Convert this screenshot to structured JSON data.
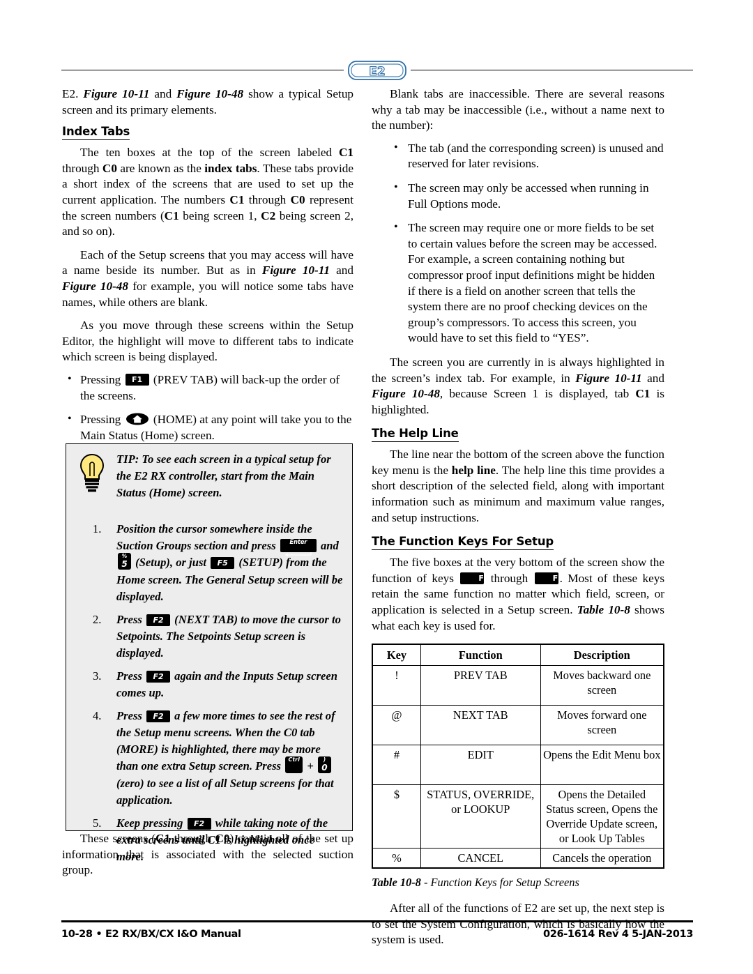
{
  "header": {
    "logo_text": "E2",
    "logo_color": "#2e6da4"
  },
  "left_column": {
    "intro_p1_a": "E2. ",
    "intro_p1_fig1": "Figure 10-11",
    "intro_p1_b": " and ",
    "intro_p1_fig2": "Figure 10-48",
    "intro_p1_c": " show a typical Setup screen and its primary elements.",
    "heading_index_tabs": "Index Tabs",
    "p_index_a": "The ten boxes at the top of the screen labeled ",
    "p_index_c1": "C1",
    "p_index_b": " through ",
    "p_index_c0": "C0",
    "p_index_c": " are known as the ",
    "p_index_bold": "index tabs",
    "p_index_d": ". These tabs provide a short index of the screens that are used to set up the current application. The numbers ",
    "p_index_c1b": "C1",
    "p_index_e": " through ",
    "p_index_c0b": "C0",
    "p_index_f": " represent the screen numbers (",
    "p_index_c1c": "C1",
    "p_index_g": " being screen 1, ",
    "p_index_c2": "C2",
    "p_index_h": " being screen 2, and so on).",
    "p_each_a": "Each of the Setup screens that you may access will have a name beside its number. But as in ",
    "p_each_fig1": "Figure 10-11",
    "p_each_b": " and ",
    "p_each_fig2": "Figure 10-48",
    "p_each_c": " for example, you will notice some tabs have names, while others are blank.",
    "p_move": "As you move through these screens within the Setup Editor, the highlight will move to different tabs to indicate which screen is being displayed.",
    "bullet1_a": "Pressing ",
    "bullet1_key": "F1",
    "bullet1_b": " (PREV TAB) will back-up the order of the screens.",
    "bullet2_a": " Pressing ",
    "bullet2_key": "home-key",
    "bullet2_b": " (HOME) at any point will take you to the Main Status (Home) screen.",
    "p_these_a": "These screens (",
    "p_these_c1": "C1",
    "p_these_b": " through ",
    "p_these_c0": "C0",
    "p_these_c": ") contain all of the set up information that is associated with the selected suction group."
  },
  "tip_box": {
    "intro": "TIP: To see each screen in a typical setup for the E2 RX controller, start from the Main Status (Home) screen.",
    "steps": [
      {
        "num": "1.",
        "a": "Position the cursor somewhere inside the Suction Groups section and press ",
        "key1": "Enter",
        "b": " and ",
        "key2_top": "%",
        "key2_bot": "5",
        "c": " (Setup), or just ",
        "key3": "F5",
        "d": " (SETUP) from the Home screen. The General Setup screen will be displayed."
      },
      {
        "num": "2.",
        "a": "Press ",
        "key1": "F2",
        "b": " (NEXT TAB) to move the cursor to Setpoints. The Setpoints Setup screen is displayed."
      },
      {
        "num": "3.",
        "a": "Press ",
        "key1": "F2",
        "b": " again and the Inputs Setup screen comes up."
      },
      {
        "num": "4.",
        "a": "Press ",
        "key1": "F2",
        "b": " a few more times to see the rest of the Setup menu screens. When the C0 tab (MORE) is highlighted, there may be more than one extra Setup screen. Press ",
        "key2": "Ctrl",
        "plus": " + ",
        "key3_top": ")",
        "key3_bot": "0",
        "c": " (zero) to see a list of all Setup screens for that application."
      },
      {
        "num": "5.",
        "a": "Keep pressing ",
        "key1": "F2",
        "b": " while taking note of the extra screens until C1 is highlighted once more."
      }
    ]
  },
  "right_column": {
    "p_blank": "Blank tabs are inaccessible. There are several reasons why a tab may be inaccessible (i.e., without a name next to the number):",
    "bullets": [
      "The tab (and the corresponding screen) is unused and reserved for later revisions.",
      "The screen may only be accessed when running in Full Options mode.",
      "The screen may require one or more fields to be set to certain values before the screen may be accessed. For example, a screen containing nothing but compressor proof input definitions might be hidden if there is a field on another screen that tells the system there are no proof checking devices on the group’s compressors. To access this screen, you would have to set this field to “YES”."
    ],
    "p_highlight_a": "The screen you are currently in is always highlighted in the screen’s index tab. For example, in ",
    "p_highlight_fig1": "Figure 10-11",
    "p_highlight_b": " and ",
    "p_highlight_fig2": "Figure 10-48",
    "p_highlight_c": ", because Screen 1 is displayed, tab ",
    "p_highlight_c1": "C1",
    "p_highlight_d": " is highlighted.",
    "heading_help_line": "The Help Line",
    "p_help_a": "The line near the bottom of the screen above the function key menu is the ",
    "p_help_bold": "help line",
    "p_help_b": ". The help line this time provides a short description of the selected field, along with important information such as minimum and maximum value ranges, and setup instructions.",
    "heading_function_keys": "The Function Keys For Setup",
    "p_five_a": "The five boxes at the very bottom of the screen show the function of keys ",
    "p_five_key1": "F1",
    "p_five_b": " through ",
    "p_five_key2": "F5",
    "p_five_c": ". Most of these keys retain the same function no matter which field, screen, or application is selected in a Setup screen. ",
    "p_five_table": "Table 10-8",
    "p_five_d": " shows what each key is used for.",
    "p_after": "After all of the functions of E2 are set up, the next step is to set the System Configuration, which is basically how the system is used."
  },
  "table": {
    "headers": [
      "Key",
      "Function",
      "Description"
    ],
    "rows": [
      [
        "!",
        "PREV TAB",
        "Moves backward one screen"
      ],
      [
        "@",
        "NEXT TAB",
        "Moves forward one screen"
      ],
      [
        "#",
        "EDIT",
        "Opens the Edit Menu box"
      ],
      [
        "$",
        "STATUS, OVERRIDE, or LOOKUP",
        "Opens the Detailed Status screen, Opens the Override Update screen, or Look Up Tables"
      ],
      [
        "%",
        "CANCEL",
        "Cancels the operation"
      ]
    ],
    "caption_bold": "Table 10-8",
    "caption_rest": " - Function Keys for Setup Screens"
  },
  "footer": {
    "left": "10-28 • E2 RX/BX/CX I&O Manual",
    "right": "026-1614 Rev 4 5-JAN-2013"
  }
}
